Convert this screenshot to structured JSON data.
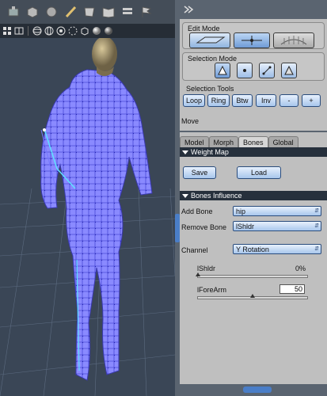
{
  "viewport_toolbar": {
    "top_icons": [
      "camera-icon",
      "cube-icon",
      "sphere-icon",
      "brush-icon",
      "mesh-icon",
      "book-icon",
      "bars-icon",
      "flag-icon"
    ],
    "bottom_icons": [
      "grid-icon",
      "window-icon",
      "wire-sphere-icon",
      "wire-sphere-2-icon",
      "lit-sphere-icon",
      "dotted-circle-icon",
      "box-icon",
      "shaded-sphere-icon",
      "smooth-sphere-icon"
    ]
  },
  "edit_mode": {
    "label": "Edit Mode"
  },
  "selection_mode": {
    "label": "Selection Mode"
  },
  "selection_tools": {
    "label": "Selection Tools",
    "buttons": [
      "Loop",
      "Ring",
      "Btw",
      "Inv",
      "-",
      "+"
    ]
  },
  "move_label": "Move",
  "tabs": [
    "Model",
    "Morph",
    "Bones",
    "Global"
  ],
  "active_tab": "Bones",
  "weight_map": {
    "header": "Weight Map",
    "save_label": "Save",
    "load_label": "Load"
  },
  "bones_influence": {
    "header": "Bones Influence",
    "add_bone_label": "Add Bone",
    "add_bone_value": "hip",
    "remove_bone_label": "Remove Bone",
    "remove_bone_value": "lShldr",
    "channel_label": "Channel",
    "channel_value": "Y Rotation",
    "lshldr_label": "lShldr",
    "lshldr_value": "0%",
    "lshldr_fraction": 0.0,
    "lforearm_label": "lForeArm",
    "lforearm_value": "50",
    "lforearm_fraction": 0.5
  },
  "colors": {
    "viewport_bg": "#3a4656",
    "mesh": "#7b7bff",
    "accent_blue": "#4a7ec8"
  }
}
